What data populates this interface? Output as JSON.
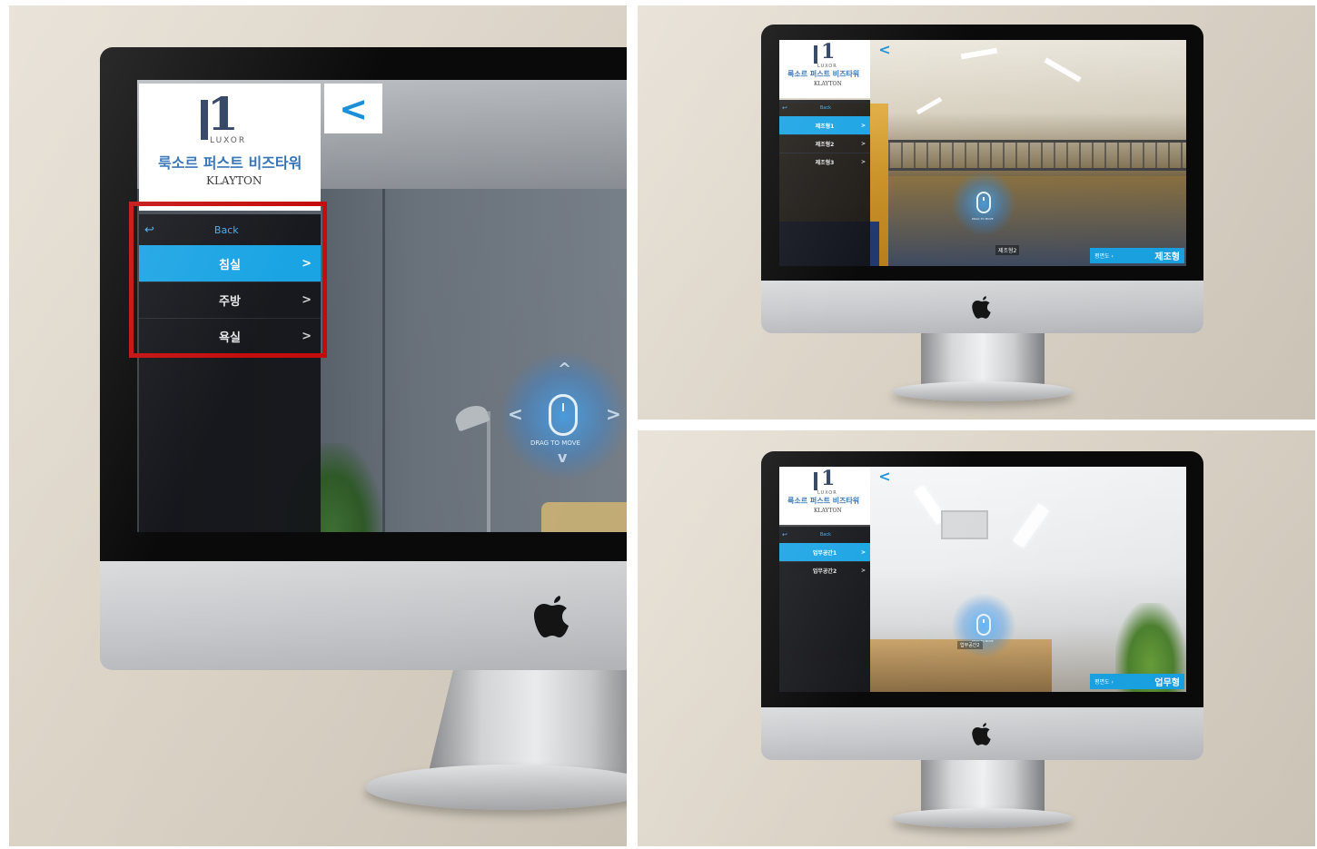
{
  "main": {
    "logo": {
      "mark": "1",
      "sub": "LUXOR",
      "name": "룩소르 퍼스트 비즈타워",
      "brand": "KLAYTON"
    },
    "back_arrow": "<",
    "menu": {
      "back_icon": "↩",
      "back_label": "Back",
      "items": [
        {
          "label": "침실",
          "active": true
        },
        {
          "label": "주방",
          "active": false
        },
        {
          "label": "욕실",
          "active": false
        }
      ],
      "chevron": ">"
    },
    "drag": {
      "label": "DRAG TO MOVE",
      "up": "^",
      "down": "v",
      "left": "<",
      "right": ">"
    },
    "apple": "",
    "highlight_color": "#c40d0d"
  },
  "factory": {
    "logo": {
      "mark": "1",
      "sub": "LUXOR",
      "name": "룩소르 퍼스트 비즈타워",
      "brand": "KLAYTON"
    },
    "back_arrow": "<",
    "menu": {
      "back_icon": "↩",
      "back_label": "Back",
      "items": [
        {
          "label": "제조형1",
          "active": true
        },
        {
          "label": "제조형2",
          "active": false
        },
        {
          "label": "제조형3",
          "active": false
        }
      ],
      "chevron": ">"
    },
    "drag": {
      "label": "DRAG TO MOVE"
    },
    "spot_label": "제조형2",
    "info_bar": {
      "left": "평면도 ›",
      "right": "제조형"
    }
  },
  "office": {
    "logo": {
      "mark": "1",
      "sub": "LUXOR",
      "name": "룩소르 퍼스트 비즈타워",
      "brand": "KLAYTON"
    },
    "back_arrow": "<",
    "menu": {
      "back_icon": "↩",
      "back_label": "Back",
      "items": [
        {
          "label": "업무공간1",
          "active": true
        },
        {
          "label": "업무공간2",
          "active": false
        }
      ],
      "chevron": ">"
    },
    "drag": {
      "label": "DRAG TO MOVE"
    },
    "spot_label": "업무공간2",
    "info_bar": {
      "left": "평면도 ›",
      "right": "업무형"
    }
  },
  "accent_color": "#1aa4e4"
}
